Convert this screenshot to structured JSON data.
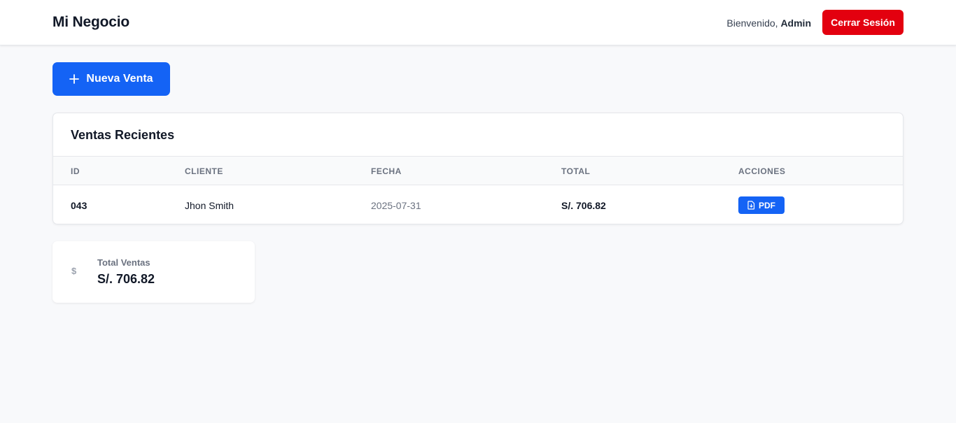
{
  "header": {
    "brand": "Mi Negocio",
    "welcome_prefix": "Bienvenido,",
    "user": "Admin",
    "logout_label": "Cerrar Sesión"
  },
  "actions": {
    "new_sale_label": "Nueva Venta"
  },
  "sales": {
    "title": "Ventas Recientes",
    "columns": [
      "ID",
      "CLIENTE",
      "FECHA",
      "TOTAL",
      "ACCIONES"
    ],
    "rows": [
      {
        "id": "043",
        "client": "Jhon Smith",
        "date": "2025-07-31",
        "total": "S/. 706.82",
        "action": "PDF"
      }
    ]
  },
  "summary": {
    "icon": "dollar-icon",
    "icon_glyph": "$",
    "label": "Total Ventas",
    "value": "S/. 706.82"
  },
  "colors": {
    "primary": "#1463f5",
    "danger": "#e3000f",
    "background": "#f8f9fb"
  }
}
